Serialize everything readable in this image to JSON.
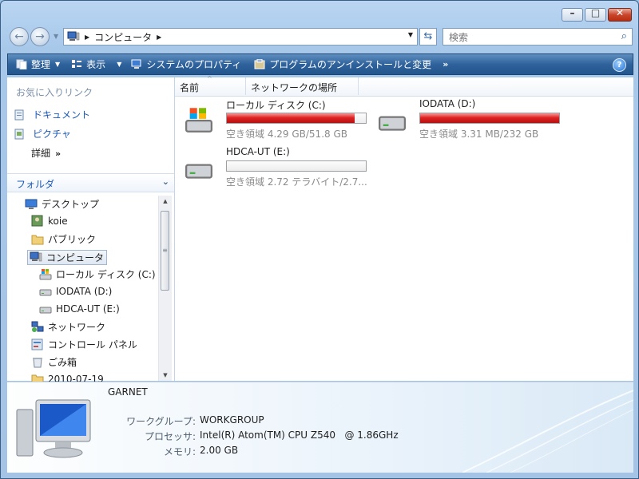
{
  "window": {
    "controls": {
      "minimize": "–",
      "maximize": "□",
      "close": "✕"
    }
  },
  "address": {
    "segment": "コンピュータ",
    "search_placeholder": "検索"
  },
  "toolbar": {
    "organize": "整理",
    "views": "表示",
    "system_properties": "システムのプロパティ",
    "uninstall": "プログラムのアンインストールと変更",
    "more": "»",
    "help": "?"
  },
  "nav": {
    "favorites_header": "お気に入りリンク",
    "favorites": [
      "ドキュメント",
      "ピクチャ"
    ],
    "more_label": "詳細",
    "folders_header": "フォルダ",
    "tree": [
      {
        "label": "デスクトップ",
        "icon": "desktop-icon"
      },
      {
        "label": "koie",
        "icon": "user-folder-icon"
      },
      {
        "label": "パブリック",
        "icon": "folder-icon"
      },
      {
        "label": "コンピュータ",
        "icon": "computer-icon",
        "selected": true
      },
      {
        "label": "ローカル ディスク (C:)",
        "icon": "windows-drive-icon"
      },
      {
        "label": "IODATA (D:)",
        "icon": "drive-icon"
      },
      {
        "label": "HDCA-UT (E:)",
        "icon": "drive-icon"
      },
      {
        "label": "ネットワーク",
        "icon": "network-icon"
      },
      {
        "label": "コントロール パネル",
        "icon": "control-panel-icon"
      },
      {
        "label": "ごみ箱",
        "icon": "recycle-bin-icon"
      },
      {
        "label": "2010-07-19",
        "icon": "folder-icon"
      }
    ]
  },
  "content": {
    "columns": [
      "名前",
      "ネットワークの場所"
    ],
    "drives": [
      {
        "name": "ローカル ディスク (C:)",
        "space": "空き領域 4.29 GB/51.8 GB",
        "used_fraction": 0.917,
        "icon": "windows-drive-icon"
      },
      {
        "name": "IODATA (D:)",
        "space": "空き領域 3.31 MB/232 GB",
        "used_fraction": 1.0,
        "icon": "drive-icon"
      },
      {
        "name": "HDCA-UT (E:)",
        "space": "空き領域 2.72 テラバイト/2.7...",
        "used_fraction": 0.0,
        "icon": "drive-icon"
      }
    ]
  },
  "details": {
    "computer_name": "GARNET",
    "workgroup_label": "ワークグループ:",
    "workgroup": "WORKGROUP",
    "processor_label": "プロセッサ:",
    "processor": "Intel(R) Atom(TM) CPU Z540   @ 1.86GHz",
    "memory_label": "メモリ:",
    "memory": "2.00 GB"
  },
  "colors": {
    "toolbar": "#2f629b",
    "link": "#1b59b5",
    "bar_fill": "#e02323"
  }
}
